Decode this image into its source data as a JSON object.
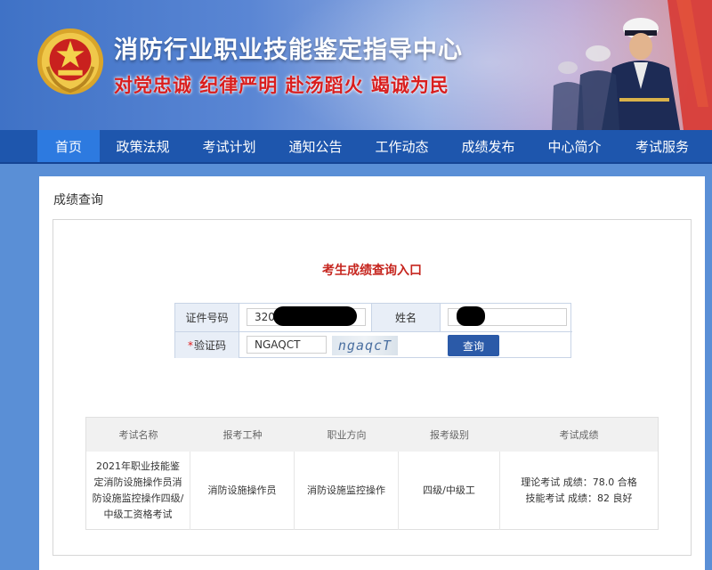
{
  "header": {
    "title": "消防行业职业技能鉴定指导中心",
    "slogan": "对党忠诚 纪律严明 赴汤蹈火 竭诚为民"
  },
  "nav": {
    "items": [
      "首页",
      "政策法规",
      "考试计划",
      "通知公告",
      "工作动态",
      "成绩发布",
      "中心简介",
      "考试服务"
    ],
    "active_index": 0
  },
  "page": {
    "section_title": "成绩查询",
    "panel_title": "考生成绩查询入口"
  },
  "form": {
    "id_label": "证件号码",
    "id_value": "320",
    "name_label": "姓名",
    "name_value": "",
    "captcha_required_mark": "*",
    "captcha_label": "验证码",
    "captcha_value": "NGAQCT",
    "captcha_image_text": "ngaqcT",
    "query_button": "查询"
  },
  "results": {
    "headers": [
      "考试名称",
      "报考工种",
      "职业方向",
      "报考级别",
      "考试成绩"
    ],
    "rows": [
      {
        "exam_name": "2021年职业技能鉴定消防设施操作员消防设施监控操作四级/中级工资格考试",
        "job_type": "消防设施操作员",
        "direction": "消防设施监控操作",
        "level": "四级/中级工",
        "score_theory": "理论考试 成绩：78.0 合格",
        "score_skill": "技能考试 成绩：82 良好"
      }
    ]
  },
  "colors": {
    "nav_bg": "#1e56ad",
    "nav_active": "#2d7ae0",
    "accent_red": "#c6261f",
    "button_blue": "#2b5aa8"
  }
}
